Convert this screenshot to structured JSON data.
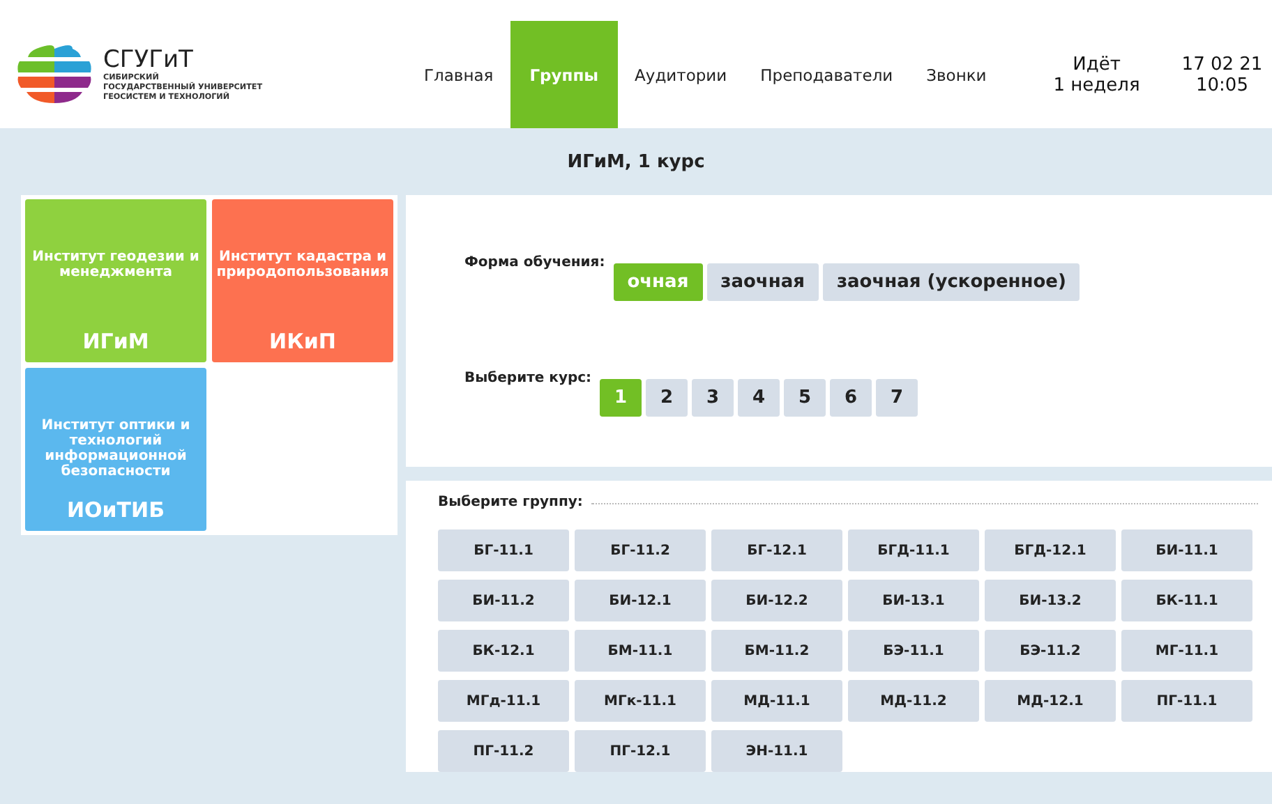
{
  "logo": {
    "name": "СГУГиТ",
    "subtitle_lines": [
      "СИБИРСКИЙ",
      "ГОСУДАРСТВЕННЫЙ УНИВЕРСИТЕТ",
      "ГЕОСИСТЕМ И ТЕХНОЛОГИЙ"
    ]
  },
  "nav": [
    {
      "label": "Главная",
      "selected": false
    },
    {
      "label": "Группы",
      "selected": true
    },
    {
      "label": "Аудитории",
      "selected": false
    },
    {
      "label": "Преподаватели",
      "selected": false
    },
    {
      "label": "Звонки",
      "selected": false
    }
  ],
  "week": [
    "Идёт",
    "1 неделя"
  ],
  "datetime": [
    "17 02 21",
    "10:05"
  ],
  "page_title": "ИГиМ, 1 курс",
  "institutes": [
    {
      "name": "Институт геодезии и менеджмента",
      "abbr": "ИГиМ",
      "color": "#8fd13f"
    },
    {
      "name": "Институт кадастра и природопользования",
      "abbr": "ИКиП",
      "color": "#fd7150"
    },
    {
      "name": "Институт оптики и технологий информационной безопасности",
      "abbr": "ИОиТИБ",
      "color": "#5bb8ee"
    }
  ],
  "study_form": {
    "label": "Форма обучения:",
    "options": [
      {
        "label": "очная",
        "selected": true
      },
      {
        "label": "заочная",
        "selected": false
      },
      {
        "label": "заочная (ускоренное)",
        "selected": false
      }
    ]
  },
  "course": {
    "label": "Выберите курс:",
    "options": [
      {
        "label": "1",
        "selected": true
      },
      {
        "label": "2",
        "selected": false
      },
      {
        "label": "3",
        "selected": false
      },
      {
        "label": "4",
        "selected": false
      },
      {
        "label": "5",
        "selected": false
      },
      {
        "label": "6",
        "selected": false
      },
      {
        "label": "7",
        "selected": false
      }
    ]
  },
  "groups": {
    "label": "Выберите группу:",
    "items": [
      "БГ-11.1",
      "БГ-11.2",
      "БГ-12.1",
      "БГД-11.1",
      "БГД-12.1",
      "БИ-11.1",
      "БИ-11.2",
      "БИ-12.1",
      "БИ-12.2",
      "БИ-13.1",
      "БИ-13.2",
      "БК-11.1",
      "БК-12.1",
      "БМ-11.1",
      "БМ-11.2",
      "БЭ-11.1",
      "БЭ-11.2",
      "МГ-11.1",
      "МГд-11.1",
      "МГк-11.1",
      "МД-11.1",
      "МД-11.2",
      "МД-12.1",
      "ПГ-11.1",
      "ПГ-11.2",
      "ПГ-12.1",
      "ЭН-11.1"
    ]
  }
}
